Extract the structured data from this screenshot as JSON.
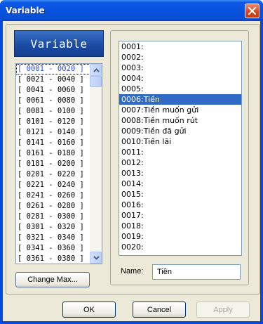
{
  "window": {
    "title": "Variable",
    "close_icon": "close-icon"
  },
  "header": {
    "label": "Variable"
  },
  "left_list": {
    "items": [
      "[ 0001 - 0020 ]",
      "[ 0021 - 0040 ]",
      "[ 0041 - 0060 ]",
      "[ 0061 - 0080 ]",
      "[ 0081 - 0100 ]",
      "[ 0101 - 0120 ]",
      "[ 0121 - 0140 ]",
      "[ 0141 - 0160 ]",
      "[ 0161 - 0180 ]",
      "[ 0181 - 0200 ]",
      "[ 0201 - 0220 ]",
      "[ 0221 - 0240 ]",
      "[ 0241 - 0260 ]",
      "[ 0261 - 0280 ]",
      "[ 0281 - 0300 ]",
      "[ 0301 - 0320 ]",
      "[ 0321 - 0340 ]",
      "[ 0341 - 0360 ]",
      "[ 0361 - 0380 ]"
    ],
    "selected_index": 0
  },
  "change_max_button": "Change Max...",
  "right_list": {
    "items": [
      "0001:",
      "0002:",
      "0003:",
      "0004:",
      "0005:",
      "0006:Tiền",
      "0007:Tiền muốn gửi",
      "0008:Tiền muốn rút",
      "0009:Tiền đã gửi",
      "0010:Tiền lãi",
      "0011:",
      "0012:",
      "0013:",
      "0014:",
      "0015:",
      "0016:",
      "0017:",
      "0018:",
      "0019:",
      "0020:"
    ],
    "selected_index": 5
  },
  "name_field": {
    "label": "Name:",
    "value": "Tiền"
  },
  "buttons": {
    "ok": "OK",
    "cancel": "Cancel",
    "apply": "Apply"
  }
}
